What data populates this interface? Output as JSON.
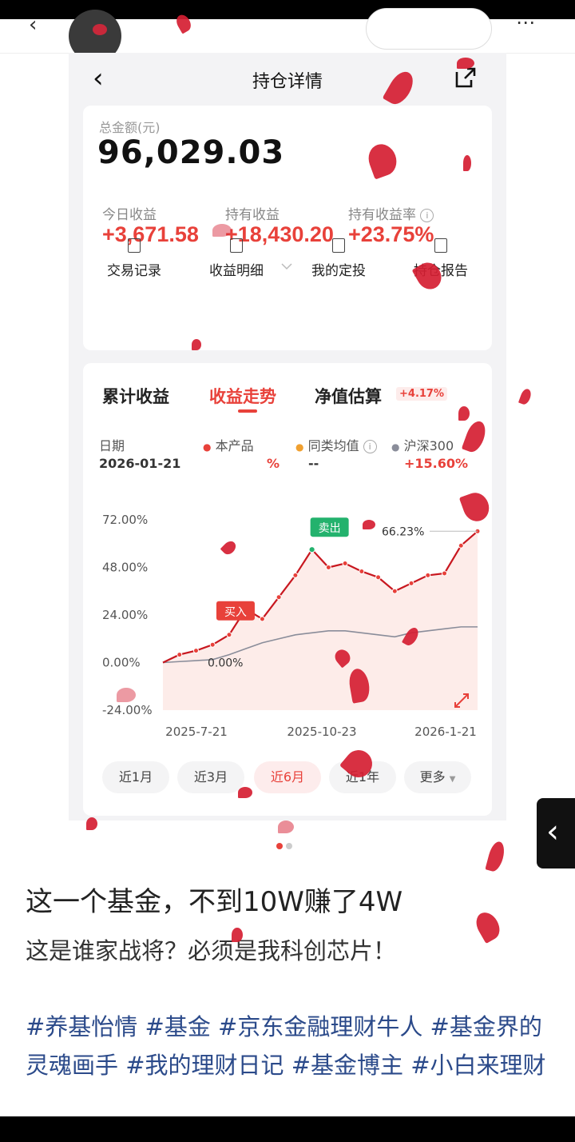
{
  "app": {
    "title": "持仓详情",
    "total_label": "总金额(元)",
    "total_value": "96,029.03",
    "stats": [
      {
        "label": "今日收益",
        "value": "+3,671.58"
      },
      {
        "label": "持有收益",
        "value": "+18,430.20"
      },
      {
        "label": "持有收益率",
        "value": "+23.75%"
      }
    ],
    "actions": [
      {
        "label": "交易记录",
        "icon": "receipt-icon"
      },
      {
        "label": "收益明细",
        "icon": "detail-icon"
      },
      {
        "label": "我的定投",
        "icon": "plan-icon"
      },
      {
        "label": "持仓报告",
        "icon": "report-icon"
      }
    ],
    "tabs": [
      "累计收益",
      "收益走势",
      "净值估算"
    ],
    "estimate_badge": "+4.17%",
    "legend": {
      "date_label": "日期",
      "date_value": "2026-01-21",
      "product_label": "本产品",
      "product_value": "%",
      "peer_label": "同类均值",
      "peer_value": "--",
      "index_label": "沪深300",
      "index_value": "+15.60%"
    },
    "period_tabs": [
      "近1月",
      "近3月",
      "近6月",
      "近1年",
      "更多"
    ],
    "colors": {
      "accent": "#e8413a",
      "index_line": "#8a8d9a",
      "sell": "#23b26d",
      "hashtag": "#2b4a8a"
    }
  },
  "chart_data": {
    "type": "line",
    "yticks": [
      "72.00%",
      "48.00%",
      "24.00%",
      "0.00%",
      "-24.00%"
    ],
    "xticks": [
      "2025-7-21",
      "2025-10-23",
      "2026-1-21"
    ],
    "ylim": [
      -24,
      72
    ],
    "x": [
      "2025-07-21",
      "2025-07-31",
      "2025-08-10",
      "2025-08-20",
      "2025-08-30",
      "2025-09-09",
      "2025-09-19",
      "2025-09-29",
      "2025-10-09",
      "2025-10-19",
      "2025-10-29",
      "2025-11-08",
      "2025-11-18",
      "2025-11-28",
      "2025-12-08",
      "2025-12-18",
      "2025-12-28",
      "2026-01-07",
      "2026-01-17",
      "2026-01-21"
    ],
    "series": [
      {
        "name": "本产品",
        "color": "#c8171f",
        "values": [
          0,
          4,
          6,
          9,
          14,
          27,
          22,
          33,
          44,
          57,
          48,
          50,
          46,
          43,
          36,
          40,
          44,
          45,
          59,
          66.23
        ]
      },
      {
        "name": "沪深300",
        "color": "#8a8d9a",
        "values": [
          0,
          0.5,
          1,
          1.5,
          4,
          7,
          10,
          12,
          14,
          15,
          16,
          16,
          15,
          14,
          13,
          15,
          16,
          17,
          18,
          18
        ]
      }
    ],
    "annotations": {
      "buy": "买入",
      "sell": "卖出",
      "max_label": "66.23%",
      "start_label": "0.00%"
    }
  },
  "post": {
    "title": "这一个基金，不到10W赚了4W",
    "subtitle": "这是谁家战将？必须是我科创芯片！",
    "tags": "#养基怡情 #基金 #京东金融理财牛人 #基金界的灵魂画手 #我的理财日记 #基金博主 #小白来理财"
  }
}
